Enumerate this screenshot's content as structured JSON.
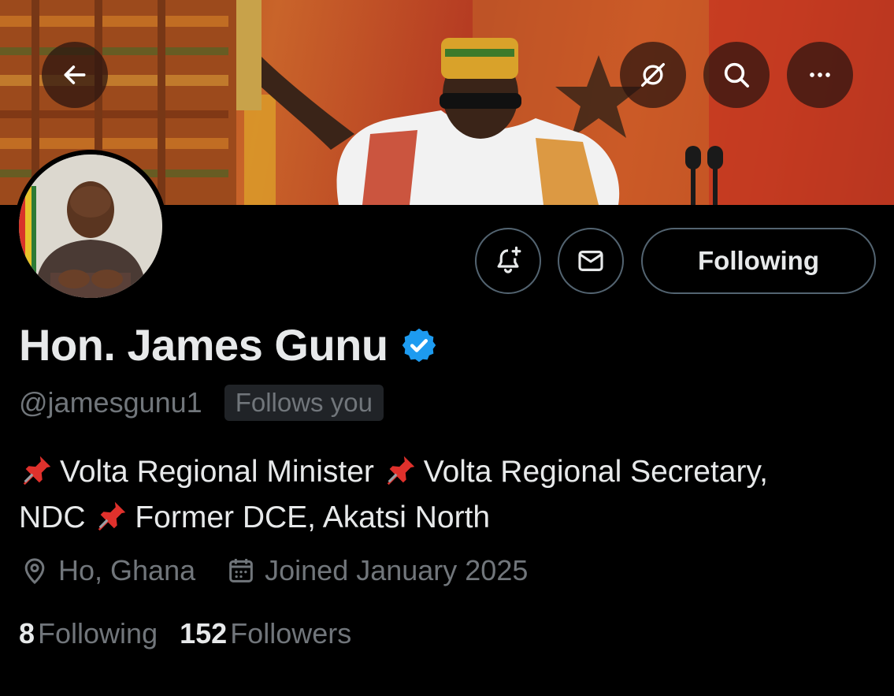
{
  "profile": {
    "display_name": "Hon. James Gunu",
    "handle": "@jamesgunu1",
    "follows_you_label": "Follows you",
    "verified": true,
    "bio_line1_a": "Volta Regional Minister",
    "bio_line1_b": "Volta Regional Secretary,",
    "bio_line2_a": "NDC",
    "bio_line2_b": "Former DCE, Akatsi North",
    "location": "Ho, Ghana",
    "joined": "Joined January 2025"
  },
  "stats": {
    "following_count": "8",
    "following_label": "Following",
    "followers_count": "152",
    "followers_label": "Followers"
  },
  "actions": {
    "following_button": "Following"
  },
  "icons": {
    "back": "arrow-left-icon",
    "grok": "grok-icon",
    "search": "search-icon",
    "more": "more-icon",
    "notify": "bell-plus-icon",
    "message": "envelope-icon",
    "verified": "verified-badge-icon",
    "location": "location-pin-icon",
    "calendar": "calendar-icon",
    "pin_emoji": "pushpin-icon"
  },
  "colors": {
    "background": "#000000",
    "text_primary": "#e7e9ea",
    "text_secondary": "#71767b",
    "verified_blue": "#1d9bf0",
    "border": "#536471"
  }
}
